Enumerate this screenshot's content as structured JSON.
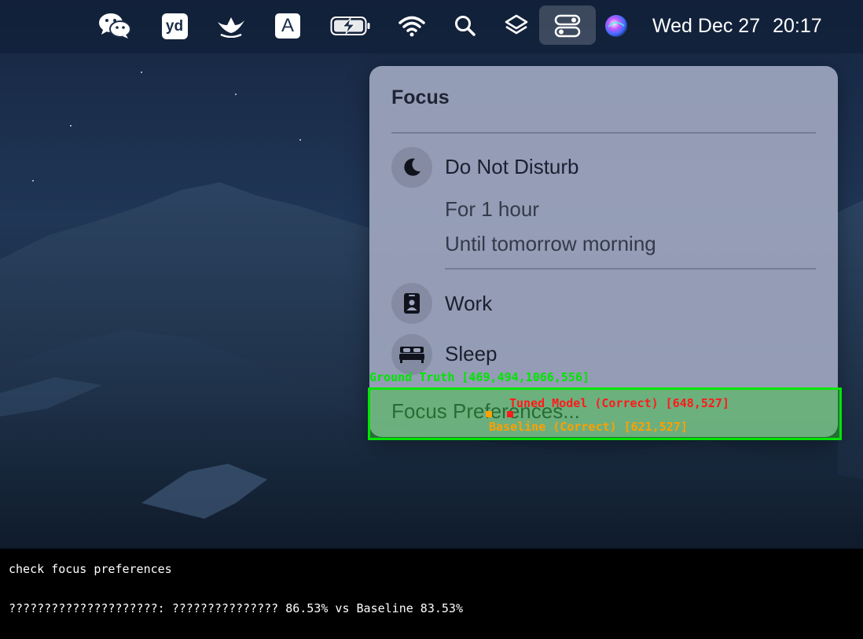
{
  "menubar": {
    "icons": [
      "wechat-icon",
      "youdao-dict-icon",
      "bird-app-icon",
      "input-source-icon",
      "battery-charging-icon",
      "wifi-icon",
      "spotlight-search-icon",
      "layers-app-icon",
      "control-center-icon",
      "siri-icon"
    ],
    "input_source_letter": "A",
    "youdao_text": "yd",
    "date": "Wed Dec 27",
    "time": "20:17"
  },
  "focus_panel": {
    "title": "Focus",
    "items": [
      {
        "label": "Do Not Disturb",
        "icon": "moon-icon"
      },
      {
        "label": "Work",
        "icon": "id-badge-icon"
      },
      {
        "label": "Sleep",
        "icon": "bed-icon"
      }
    ],
    "dnd_options": [
      "For 1 hour",
      "Until tomorrow morning"
    ],
    "preferences_label": "Focus Preferences..."
  },
  "annotations": {
    "ground_truth": "Ground Truth [469,494,1066,556]",
    "tuned": "Tuned Model (Correct) [648,527]",
    "baseline": "Baseline (Correct) [621,527]"
  },
  "caption": {
    "instruction": "check focus preferences",
    "score_line": "?????????????????????: ??????????????? 86.53% vs Baseline 83.53%"
  },
  "colors": {
    "ground_truth": "#00e600",
    "tuned": "#ff1a1a",
    "baseline": "#ff9f00"
  }
}
